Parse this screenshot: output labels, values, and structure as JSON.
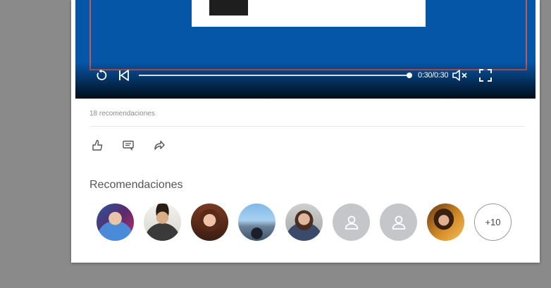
{
  "video": {
    "time_display": "0:30/0:30",
    "progress_fraction": 1.0,
    "colors": {
      "background": "#0656a8",
      "outline": "#c25a5a"
    }
  },
  "post": {
    "recommendation_count": "18 recomendaciones"
  },
  "actions": {
    "icons": [
      "thumbs-up-icon",
      "comment-icon",
      "share-icon"
    ]
  },
  "recommendations": {
    "title": "Recomendaciones",
    "more_label": "+10",
    "avatars": [
      "person-1",
      "person-2",
      "person-3",
      "person-4",
      "person-5",
      "placeholder",
      "placeholder",
      "person-6"
    ]
  }
}
